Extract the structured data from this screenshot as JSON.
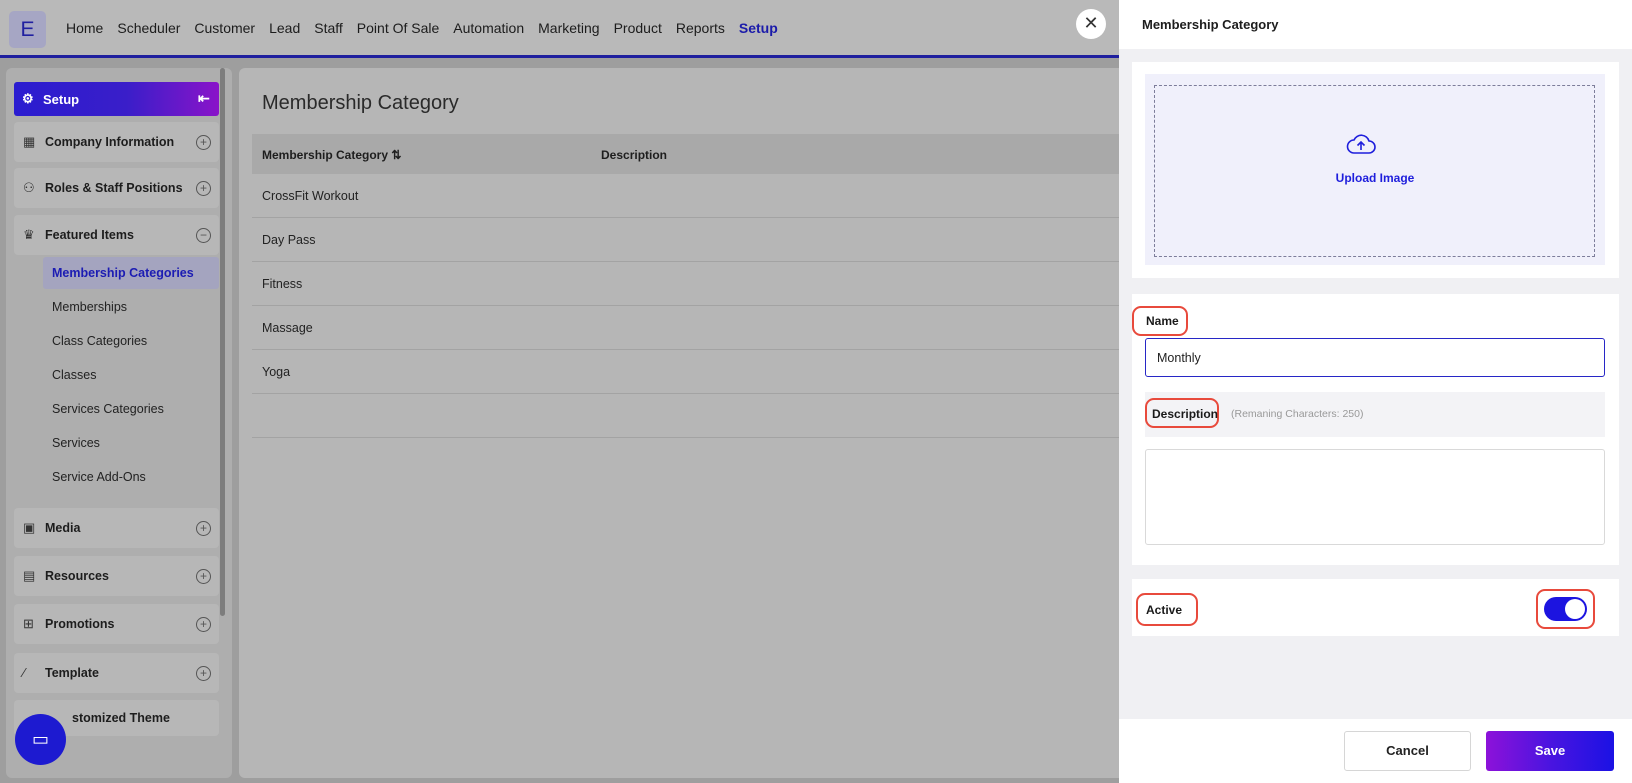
{
  "app": {
    "logo_letter": "E"
  },
  "nav": {
    "items": [
      "Home",
      "Scheduler",
      "Customer",
      "Lead",
      "Staff",
      "Point Of Sale",
      "Automation",
      "Marketing",
      "Product",
      "Reports",
      "Setup"
    ],
    "active": "Setup"
  },
  "sidebar": {
    "header": "Setup",
    "groups": [
      {
        "label": "Company Information",
        "icon": "building-icon",
        "state": "collapsed"
      },
      {
        "label": "Roles & Staff Positions",
        "icon": "users-icon",
        "state": "collapsed"
      },
      {
        "label": "Featured Items",
        "icon": "crown-icon",
        "state": "expanded"
      },
      {
        "label": "Media",
        "icon": "media-icon",
        "state": "collapsed"
      },
      {
        "label": "Resources",
        "icon": "resources-icon",
        "state": "collapsed"
      },
      {
        "label": "Promotions",
        "icon": "gift-icon",
        "state": "collapsed"
      },
      {
        "label": "Template",
        "icon": "wand-icon",
        "state": "collapsed"
      },
      {
        "label": "stomized Theme",
        "icon": "",
        "state": "none"
      }
    ],
    "featured_items": [
      "Membership Categories",
      "Memberships",
      "Class Categories",
      "Classes",
      "Services Categories",
      "Services",
      "Service Add-Ons"
    ],
    "active_item": "Membership Categories"
  },
  "main": {
    "title": "Membership Category",
    "columns": [
      "Membership Category",
      "Description"
    ],
    "rows": [
      "CrossFit Workout",
      "Day Pass",
      "Fitness",
      "Massage",
      "Yoga"
    ]
  },
  "drawer": {
    "title": "Membership Category",
    "upload_label": "Upload Image",
    "name_label": "Name",
    "name_value": "Monthly",
    "description_label": "Description",
    "description_hint": "(Remaning Characters: 250)",
    "description_value": "",
    "active_label": "Active",
    "active_on": true,
    "cancel_label": "Cancel",
    "save_label": "Save"
  },
  "colors": {
    "accent": "#1c14e0",
    "highlight": "#e84a3c",
    "gradient_end": "#8d12d9"
  }
}
